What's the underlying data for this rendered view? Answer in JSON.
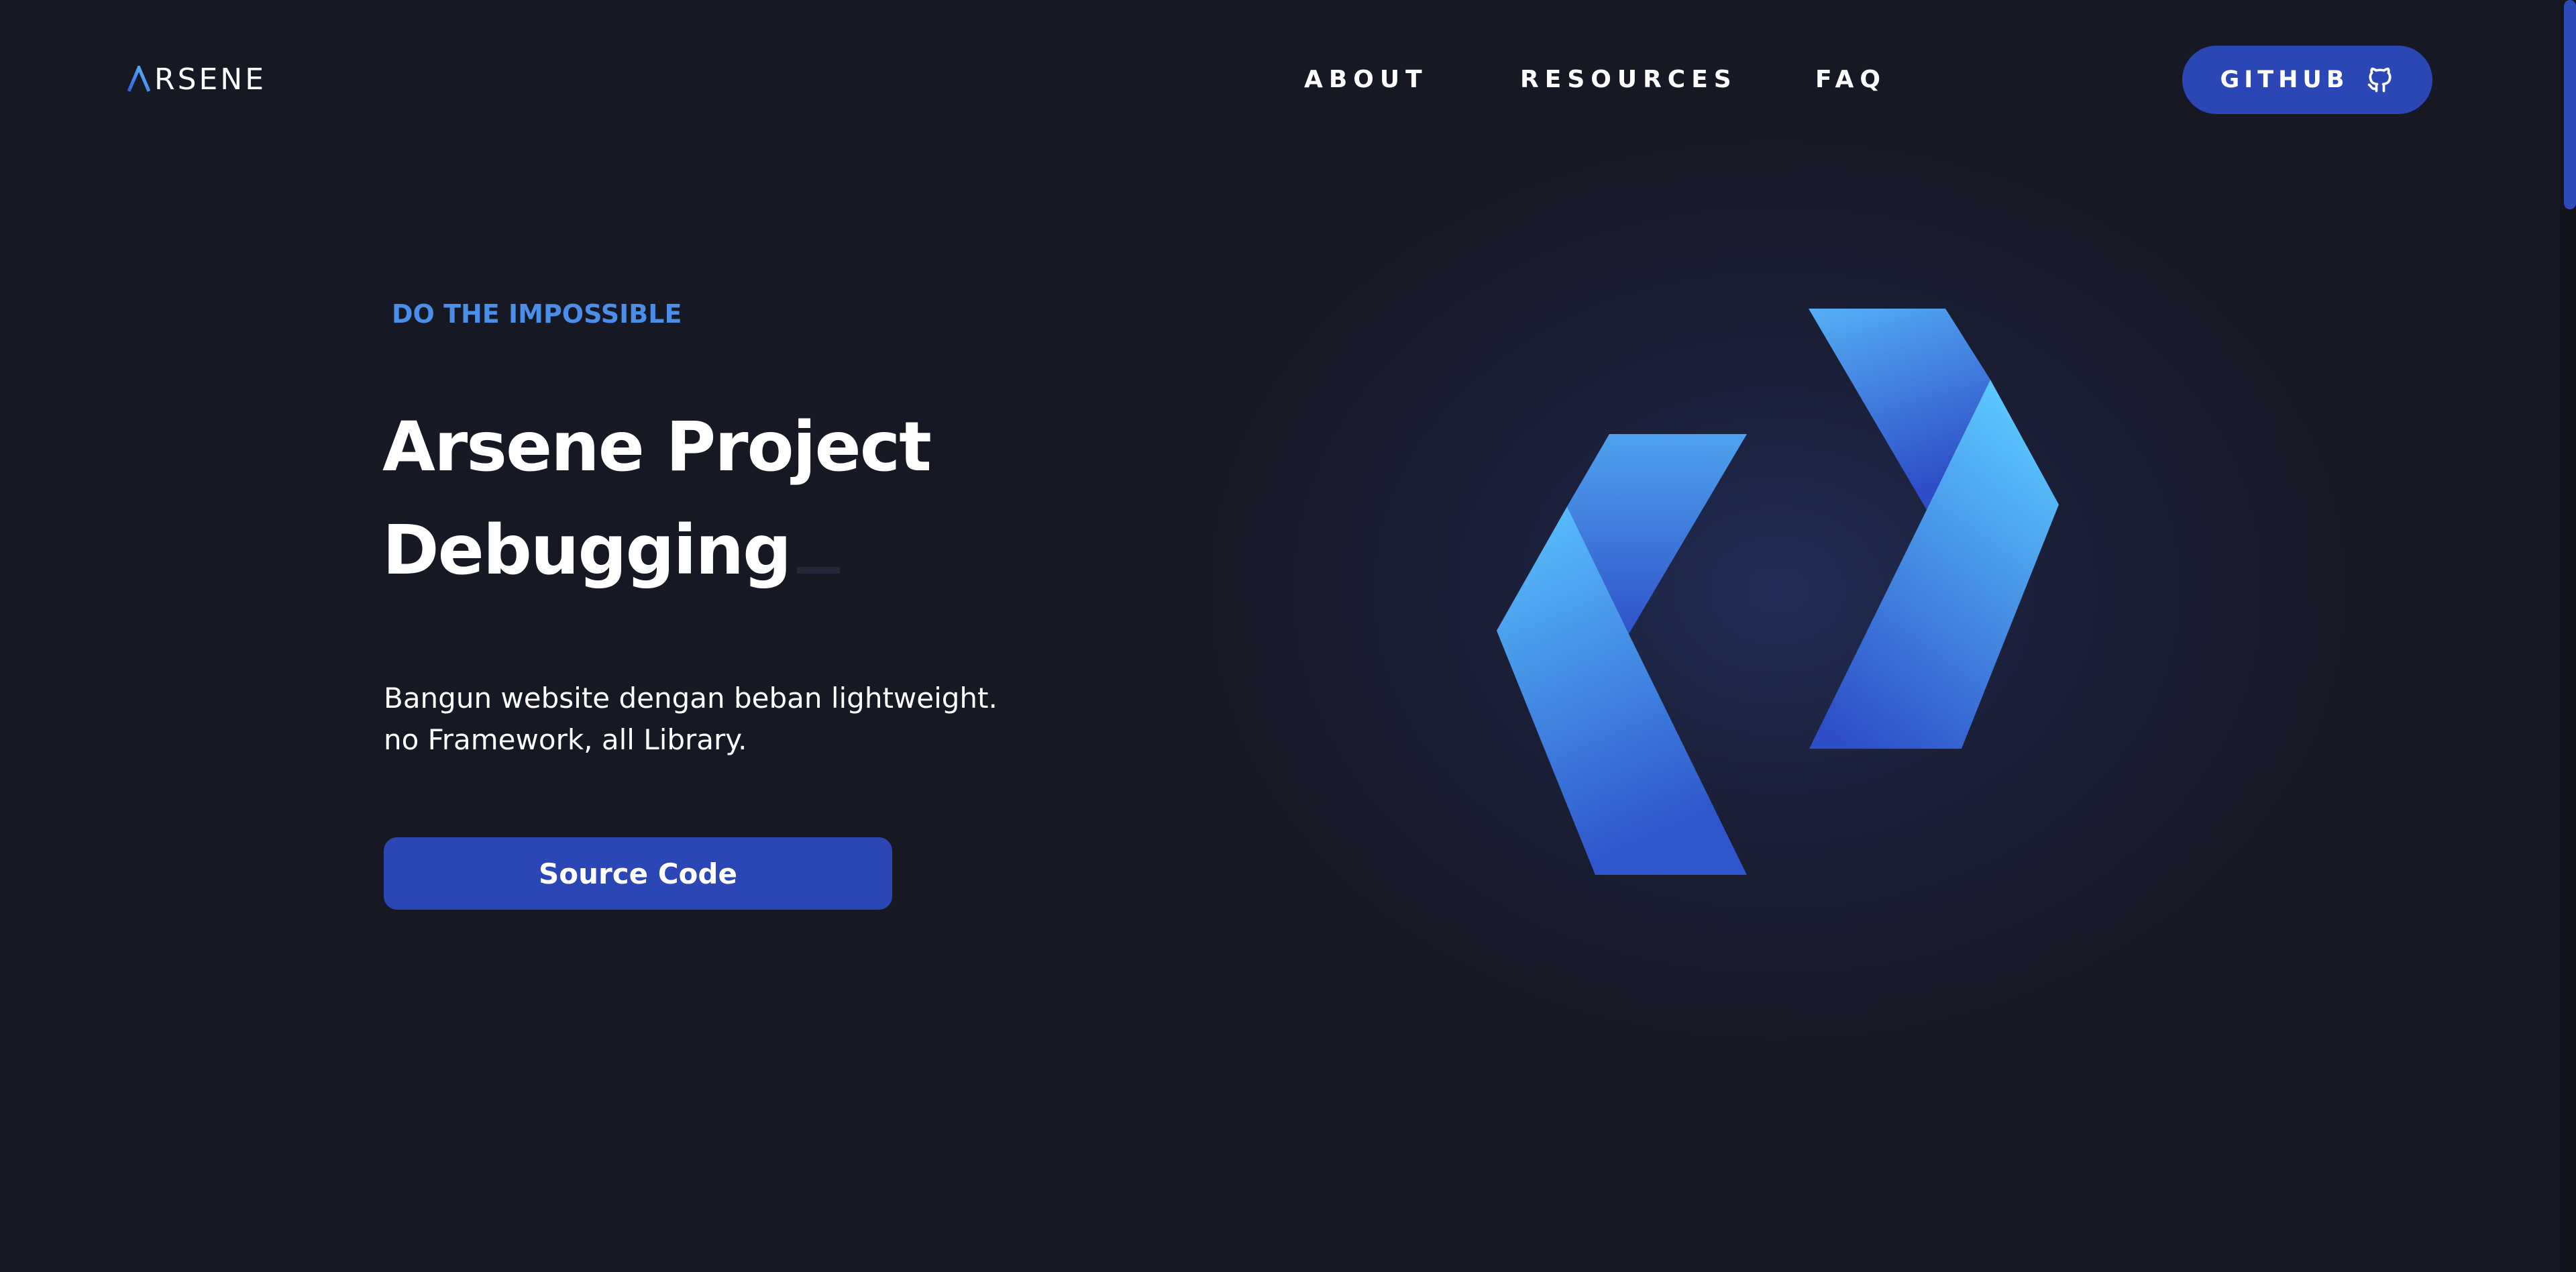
{
  "header": {
    "logo_text": "RSENE",
    "logo_mark_icon": "chevron-a-logo-icon",
    "nav": {
      "about": "ABOUT",
      "resources": "RESOURCES",
      "faq": "FAQ"
    },
    "github_button": {
      "label": "GITHUB",
      "icon": "github-icon"
    }
  },
  "hero": {
    "eyebrow": "DO THE IMPOSSIBLE",
    "title_line1": "Arsene Project",
    "title_line2": "Debugging",
    "description_line1": "Bangun website dengan beban lightweight.",
    "description_line2": "no Framework, all Library.",
    "cta_label": "Source Code",
    "art_icon": "code-brackets-logo-icon"
  },
  "colors": {
    "background": "#161824",
    "accent": "#2b46b5",
    "eyebrow": "#4a8ee8",
    "art_light": "#5bc0ff",
    "art_dark": "#2f4fcb"
  }
}
